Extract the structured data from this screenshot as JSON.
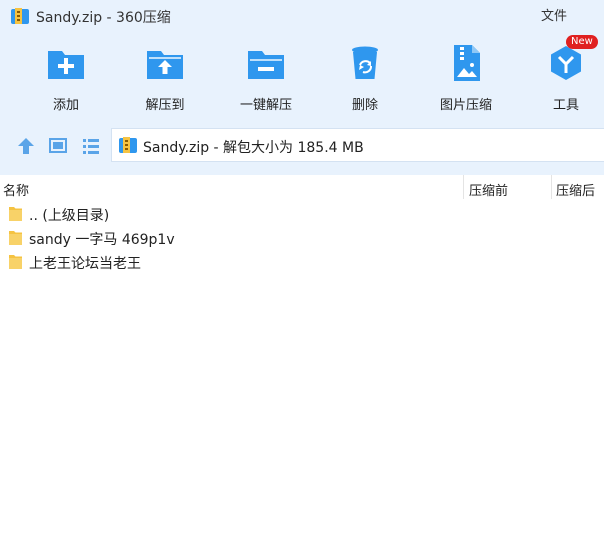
{
  "window": {
    "title": "Sandy.zip - 360压缩",
    "menu_file": "文件"
  },
  "toolbar": {
    "items": [
      {
        "label": "添加"
      },
      {
        "label": "解压到"
      },
      {
        "label": "一键解压"
      },
      {
        "label": "删除"
      },
      {
        "label": "图片压缩"
      },
      {
        "label": "工具"
      }
    ],
    "badge": "New"
  },
  "address": {
    "text": "Sandy.zip - 解包大小为 185.4 MB"
  },
  "columns": {
    "name": "名称",
    "before": "压缩前",
    "after": "压缩后"
  },
  "files": [
    {
      "name": ".. (上级目录)"
    },
    {
      "name": "sandy 一字马 469p1v"
    },
    {
      "name": "上老王论坛当老王"
    }
  ],
  "colors": {
    "accent": "#2f97ee",
    "folder": "#f5c342",
    "toolbar_bg": "#e8f2fd",
    "badge": "#e02020"
  }
}
